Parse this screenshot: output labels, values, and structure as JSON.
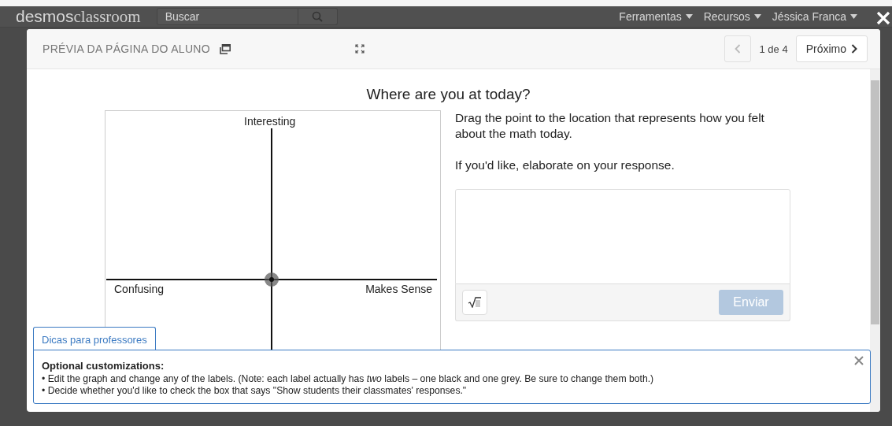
{
  "background": {
    "logo": {
      "brand": "desmos",
      "product": "classroom"
    },
    "search": {
      "placeholder": "Buscar"
    },
    "menus": [
      {
        "label": "Ferramentas"
      },
      {
        "label": "Recursos"
      },
      {
        "label": "Jéssica Franca"
      }
    ]
  },
  "modal": {
    "title": "PRÉVIA DA PÁGINA DO ALUNO",
    "pager": {
      "previous_disabled": true,
      "position": "1 de 4",
      "next": "Próximo"
    }
  },
  "page": {
    "heading": "Where are you at today?",
    "graph": {
      "top_label": "Interesting",
      "left_label": "Confusing",
      "right_label": "Makes Sense"
    },
    "prompt": [
      "Drag the point to the location that represents how you felt about the math today.",
      "If you'd like, elaborate on your response."
    ],
    "response": {
      "submit": {
        "label": "Enviar",
        "disabled": true
      }
    }
  },
  "tips": {
    "tab": "Dicas para professores",
    "heading": "Optional customizations:",
    "items": [
      "• Edit the graph and change any of the labels. (Note: each label actually has *two* labels – one black and one grey. Be sure to change them both.)",
      "• Decide whether you'd like to check the box that says \"Show students their classmates' responses.\""
    ]
  }
}
